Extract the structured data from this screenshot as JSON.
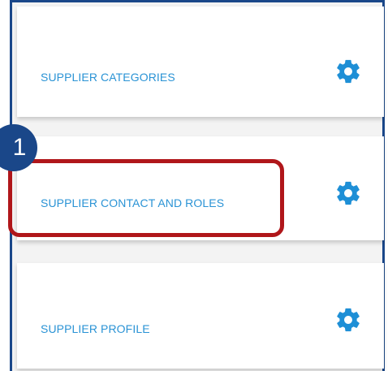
{
  "cards": [
    {
      "label": "SUPPLIER CATEGORIES",
      "icon": "gear-icon"
    },
    {
      "label": "SUPPLIER CONTACT AND ROLES",
      "icon": "gear-icon"
    },
    {
      "label": "SUPPLIER PROFILE",
      "icon": "gear-icon"
    }
  ],
  "callout": {
    "step": "1"
  },
  "colors": {
    "accent_text": "#2a93d5",
    "gear": "#1e8fd6",
    "frame": "#1a4789",
    "highlight": "#b0161a"
  }
}
